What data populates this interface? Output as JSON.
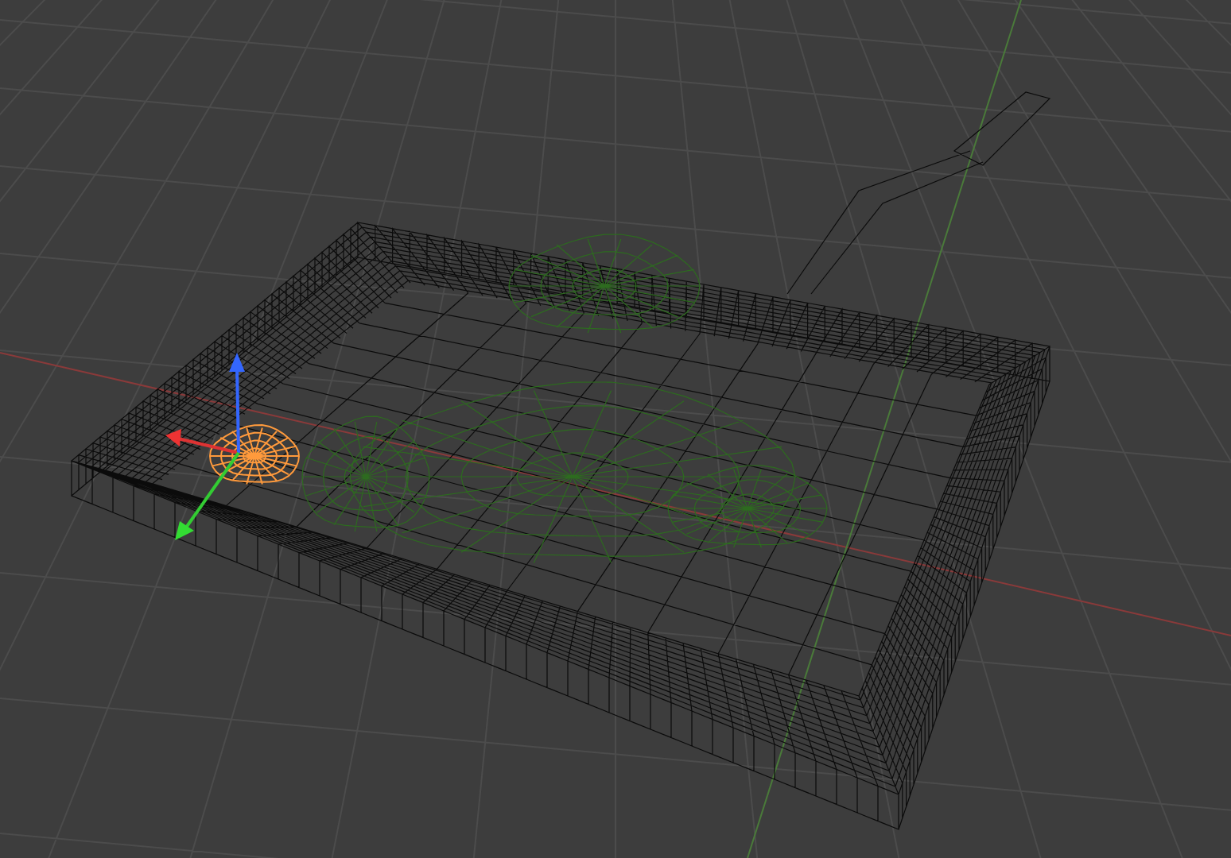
{
  "scene": {
    "objects": [
      {
        "kind": "pan",
        "selected": false
      },
      {
        "kind": "food",
        "selected": false
      },
      {
        "kind": "garnish",
        "selected": true
      }
    ]
  }
}
